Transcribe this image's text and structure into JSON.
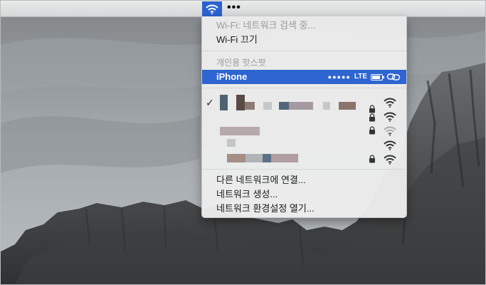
{
  "menubar": {
    "wifi_icon": "wifi-icon",
    "more_label": "•••"
  },
  "wifi_menu": {
    "status_label": "Wi-Fi: 네트워크 검색 중...",
    "turn_off_label": "Wi-Fi 끄기",
    "hotspot_header": "개인용 핫스팟",
    "hotspot": {
      "name": "iPhone",
      "signal_dots": "●●●●●",
      "network_type": "LTE",
      "battery_icon": "battery-icon",
      "link_icon": "hotspot-link-icon"
    },
    "networks": [
      {
        "connected": true,
        "locked": true,
        "wifi_icon": "wifi-icon"
      },
      {
        "connected": false,
        "locked": true,
        "wifi_icon": "wifi-icon"
      },
      {
        "connected": false,
        "locked": true,
        "wifi_icon": "wifi-icon-weak"
      },
      {
        "connected": false,
        "locked": false,
        "wifi_icon": "wifi-icon"
      },
      {
        "connected": false,
        "locked": true,
        "wifi_icon": "wifi-icon"
      }
    ],
    "check_mark": "✓",
    "actions": [
      "다른 네트워크에 연결...",
      "네트워크 생성...",
      "네트워크 환경설정 열기..."
    ]
  },
  "colors": {
    "highlight": "#2e65d1",
    "menubar_active": "#2b62d0"
  }
}
